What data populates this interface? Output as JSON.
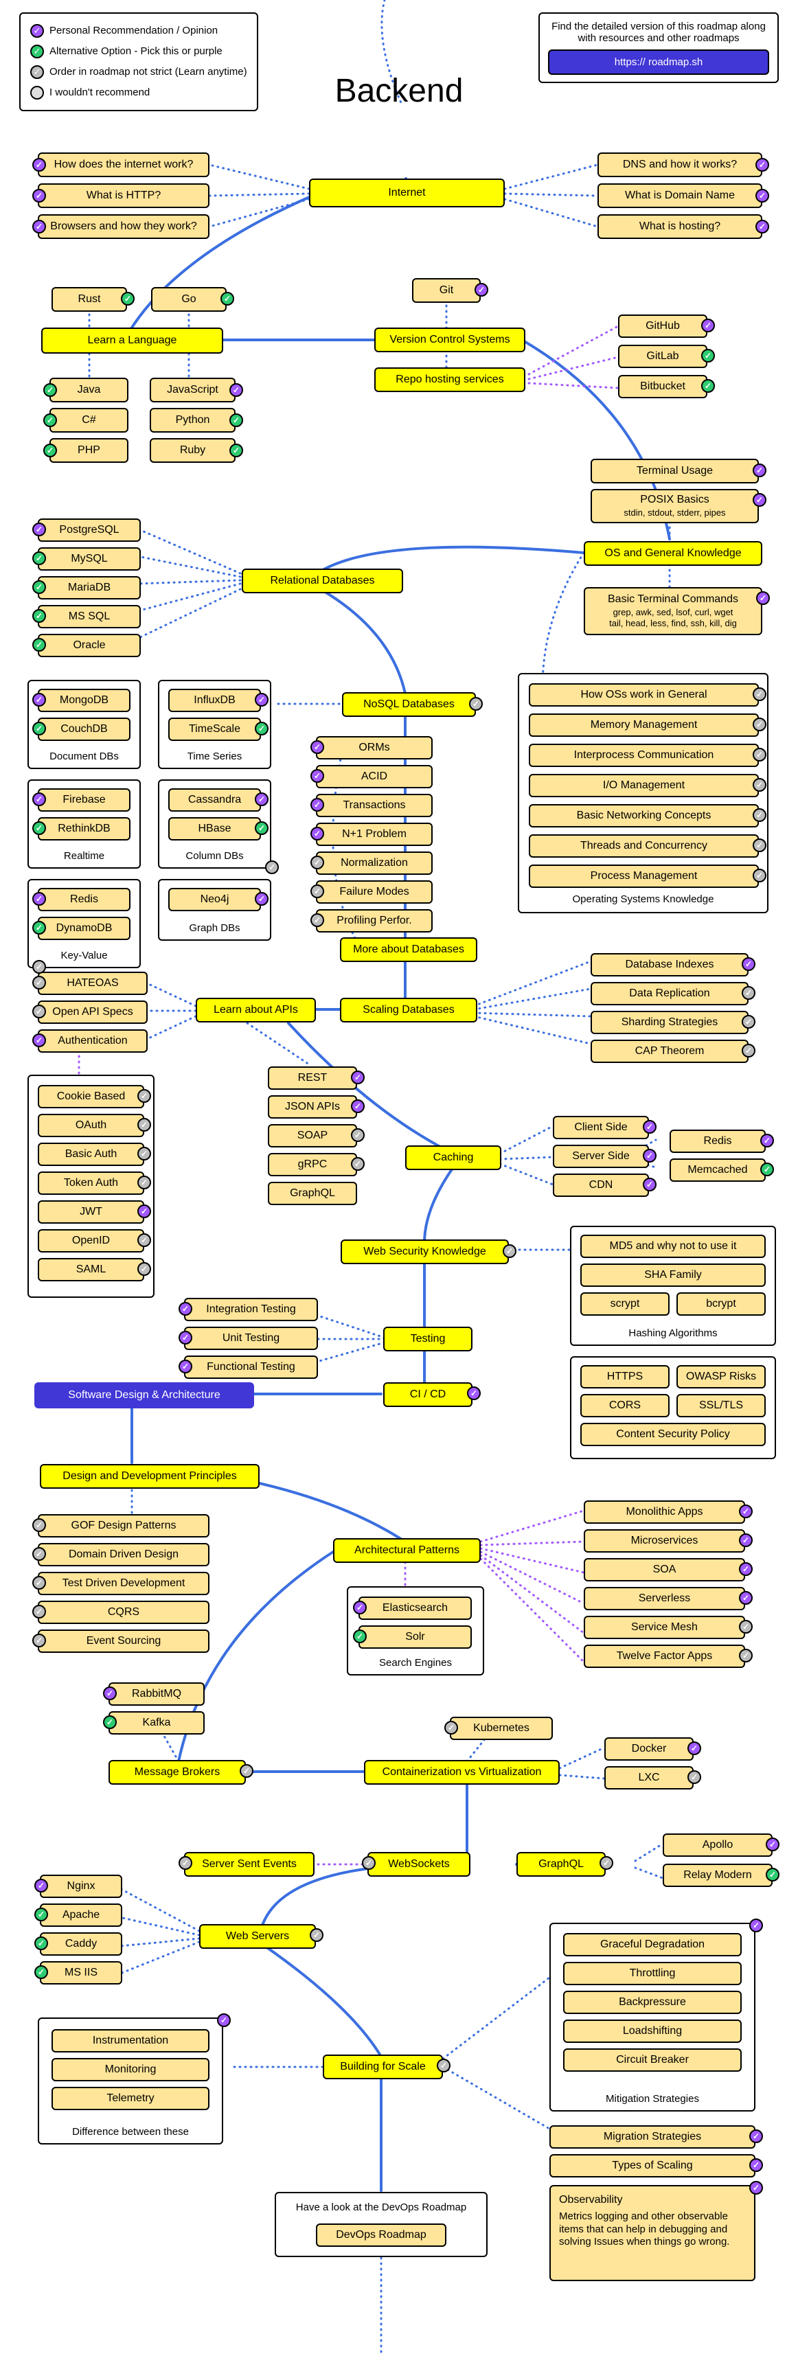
{
  "title": "Backend",
  "legend": {
    "l1": "Personal Recommendation / Opinion",
    "l2": "Alternative Option - Pick this or purple",
    "l3": "Order in roadmap not strict (Learn anytime)",
    "l4": "I wouldn't recommend"
  },
  "cta": {
    "line": "Find the detailed version of this roadmap along with resources and other roadmaps",
    "btn": "https:// roadmap.sh"
  },
  "nodes": {
    "internet": "Internet",
    "int_how": "How does the internet work?",
    "int_http": "What is HTTP?",
    "int_browsers": "Browsers and how they work?",
    "int_dns": "DNS and how it works?",
    "int_domain": "What is Domain Name",
    "int_hosting": "What is hosting?",
    "lang": "Learn a Language",
    "rust": "Rust",
    "go": "Go",
    "java": "Java",
    "csharp": "C#",
    "php": "PHP",
    "js": "JavaScript",
    "python": "Python",
    "ruby": "Ruby",
    "vcs": "Version Control Systems",
    "git": "Git",
    "repo": "Repo hosting services",
    "github": "GitHub",
    "gitlab": "GitLab",
    "bitbucket": "Bitbucket",
    "osgk": "OS and General Knowledge",
    "terminal": "Terminal Usage",
    "posix_t": "POSIX Basics",
    "posix_s": "stdin, stdout, stderr, pipes",
    "btc_t": "Basic Terminal Commands",
    "btc_s1": "grep, awk, sed, lsof, curl, wget",
    "btc_s2": "tail, head, less, find, ssh, kill, dig",
    "osk_general": "How OSs work in General",
    "osk_mem": "Memory Management",
    "osk_ipc": "Interprocess Communication",
    "osk_io": "I/O Management",
    "osk_net": "Basic Networking Concepts",
    "osk_thread": "Threads and Concurrency",
    "osk_proc": "Process Management",
    "osk_caption": "Operating Systems Knowledge",
    "rdb": "Relational Databases",
    "postgres": "PostgreSQL",
    "mysql": "MySQL",
    "mariadb": "MariaDB",
    "mssql": "MS SQL",
    "oracle": "Oracle",
    "nosql": "NoSQL Databases",
    "mongo": "MongoDB",
    "couch": "CouchDB",
    "doc_caption": "Document DBs",
    "influx": "InfluxDB",
    "timescale": "TimeScale",
    "ts_caption": "Time Series",
    "firebase": "Firebase",
    "rethink": "RethinkDB",
    "rt_caption": "Realtime",
    "cassandra": "Cassandra",
    "hbase": "HBase",
    "col_caption": "Column DBs",
    "redis": "Redis",
    "dynamo": "DynamoDB",
    "kv_caption": "Key-Value",
    "neo4j": "Neo4j",
    "graph_caption": "Graph DBs",
    "more_db": "More about Databases",
    "orms": "ORMs",
    "acid": "ACID",
    "tx": "Transactions",
    "n1": "N+1 Problem",
    "norm": "Normalization",
    "fail": "Failure Modes",
    "prof": "Profiling Perfor.",
    "scaling_db": "Scaling Databases",
    "idx": "Database Indexes",
    "repl": "Data Replication",
    "shard": "Sharding Strategies",
    "cap": "CAP Theorem",
    "apis": "Learn about APIs",
    "hateoas": "HATEOAS",
    "openapi": "Open API Specs",
    "auth": "Authentication",
    "cookie": "Cookie Based",
    "oauth": "OAuth",
    "basicauth": "Basic Auth",
    "tokenauth": "Token Auth",
    "jwt": "JWT",
    "openid": "OpenID",
    "saml": "SAML",
    "rest": "REST",
    "jsonapi": "JSON APIs",
    "soap": "SOAP",
    "grpc": "gRPC",
    "graphql": "GraphQL",
    "caching": "Caching",
    "clientside": "Client Side",
    "serverside": "Server Side",
    "cdn": "CDN",
    "c_redis": "Redis",
    "memcached": "Memcached",
    "websec": "Web Security Knowledge",
    "md5": "MD5 and why not to use it",
    "sha": "SHA Family",
    "scrypt": "scrypt",
    "bcrypt": "bcrypt",
    "hash_caption": "Hashing Algorithms",
    "https": "HTTPS",
    "owasp": "OWASP Risks",
    "cors": "CORS",
    "ssltls": "SSL/TLS",
    "csp": "Content Security Policy",
    "testing": "Testing",
    "itest": "Integration Testing",
    "utest": "Unit Testing",
    "ftest": "Functional Testing",
    "cicd": "CI / CD",
    "sda": "Software Design & Architecture",
    "ddp": "Design and Development Principles",
    "gof": "GOF Design Patterns",
    "ddd": "Domain Driven Design",
    "tdd": "Test Driven Development",
    "cqrs": "CQRS",
    "es": "Event Sourcing",
    "arch": "Architectural Patterns",
    "mono": "Monolithic Apps",
    "micro": "Microservices",
    "soa": "SOA",
    "serverless": "Serverless",
    "mesh": "Service Mesh",
    "twelve": "Twelve Factor Apps",
    "se_caption": "Search Engines",
    "elastic": "Elasticsearch",
    "solr": "Solr",
    "rabbit": "RabbitMQ",
    "kafka": "Kafka",
    "brokers": "Message Brokers",
    "contvirt": "Containerization vs Virtualization",
    "k8s": "Kubernetes",
    "docker": "Docker",
    "lxc": "LXC",
    "sse": "Server Sent Events",
    "ws": "WebSockets",
    "gql2": "GraphQL",
    "apollo": "Apollo",
    "relay": "Relay Modern",
    "webservers": "Web Servers",
    "nginx": "Nginx",
    "apache": "Apache",
    "caddy": "Caddy",
    "iis": "MS IIS",
    "bfs": "Building for Scale",
    "instr": "Instrumentation",
    "monitor": "Monitoring",
    "telemetry": "Telemetry",
    "diff_caption": "Difference between these",
    "grace": "Graceful Degradation",
    "throttle": "Throttling",
    "backp": "Backpressure",
    "loadshift": "Loadshifting",
    "circuit": "Circuit Breaker",
    "mitig_caption": "Mitigation Strategies",
    "migstrat": "Migration Strategies",
    "typescale": "Types of Scaling",
    "obs_t": "Observability",
    "obs_s": "Metrics logging and other observable items that can help in debugging and solving Issues when things go wrong.",
    "devops_hint": "Have a look at the DevOps Roadmap",
    "devops": "DevOps Roadmap"
  }
}
